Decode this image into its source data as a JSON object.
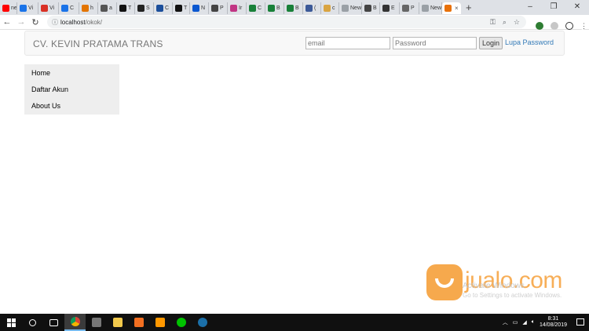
{
  "browser": {
    "tabs": [
      {
        "label": "ne",
        "color": "#ff0000"
      },
      {
        "label": "Vi",
        "color": "#1a73e8"
      },
      {
        "label": "Vi",
        "color": "#d93025"
      },
      {
        "label": "C",
        "color": "#1a73e8"
      },
      {
        "label": "h",
        "color": "#e37400"
      },
      {
        "label": "a",
        "color": "#555555"
      },
      {
        "label": "T",
        "color": "#111111"
      },
      {
        "label": "S",
        "color": "#222222"
      },
      {
        "label": "C",
        "color": "#1b4e9b"
      },
      {
        "label": "T",
        "color": "#111111"
      },
      {
        "label": "N",
        "color": "#0b57d0"
      },
      {
        "label": "P",
        "color": "#444444"
      },
      {
        "label": "Ir",
        "color": "#c13584"
      },
      {
        "label": "C",
        "color": "#188038"
      },
      {
        "label": "B",
        "color": "#188038"
      },
      {
        "label": "B",
        "color": "#188038"
      },
      {
        "label": "(",
        "color": "#3b5998"
      },
      {
        "label": "c",
        "color": "#d9a441"
      },
      {
        "label": "New",
        "color": "#9aa0a6"
      },
      {
        "label": "B",
        "color": "#444444"
      },
      {
        "label": "E",
        "color": "#333333"
      },
      {
        "label": "P",
        "color": "#666666"
      },
      {
        "label": "New",
        "color": "#9aa0a6"
      }
    ],
    "active_tab": {
      "label": "",
      "color": "#e8710a"
    },
    "new_tab_symbol": "+",
    "window_controls": {
      "minimize": "–",
      "maximize": "❐",
      "close": "✕"
    },
    "address": {
      "host": "localhost",
      "path": "/okok/"
    },
    "nav": {
      "back": "←",
      "forward": "→",
      "reload": "↻"
    }
  },
  "page": {
    "brand": "CV. KEVIN PRATAMA TRANS",
    "login": {
      "email_placeholder": "email",
      "password_placeholder": "Password",
      "login_label": "Login",
      "forgot_label": "Lupa Password"
    },
    "sidebar": [
      {
        "label": "Home"
      },
      {
        "label": "Daftar Akun"
      },
      {
        "label": "About Us"
      }
    ]
  },
  "watermark": {
    "activate_title": "Activate Windows",
    "activate_sub": "Go to Settings to activate Windows.",
    "jualo": "jualo.com"
  },
  "taskbar": {
    "time": "8:31",
    "date": "14/08/2019",
    "apps": [
      {
        "name": "search",
        "color": "#ffffff"
      },
      {
        "name": "task-view",
        "color": "#ffffff"
      },
      {
        "name": "chrome",
        "color": "#f4b400"
      },
      {
        "name": "terminal",
        "color": "#777777"
      },
      {
        "name": "explorer",
        "color": "#f2c94c"
      },
      {
        "name": "xampp",
        "color": "#f36f21"
      },
      {
        "name": "sublime",
        "color": "#ff9800"
      },
      {
        "name": "line",
        "color": "#00c300"
      },
      {
        "name": "steam",
        "color": "#1b6fa8"
      }
    ]
  }
}
